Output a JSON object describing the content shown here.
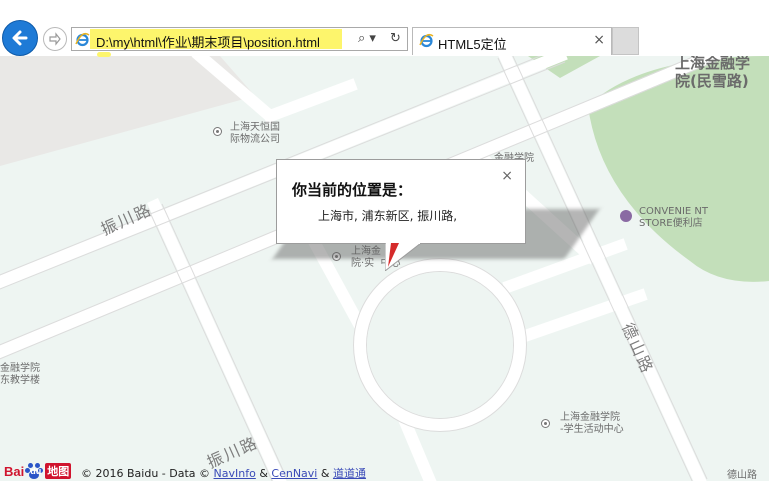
{
  "browser": {
    "back_label": "←",
    "forward_label": "⇨",
    "url": "D:\\my\\html\\作业\\期末项目\\position.html",
    "search_icon_glyph": "⌕ ▾",
    "refresh_glyph": "↻",
    "tab_title": "HTML5定位",
    "tab_close": "×"
  },
  "map": {
    "labels": {
      "tianheng": "上海天恒国\n际物流公司",
      "jinrong_top": "上海金融学\n院(民雪路)",
      "jinrong_partial": "金融学院\n  食堂",
      "convenience": "CONVENIE NT\nSTORE便利店",
      "shixun": "上海金\n院·实  中心",
      "jiaoxue": "金融学院\n东教学楼",
      "student_center": "上海金融学院\n-学生活动中心",
      "deshan_bottom": "德山路"
    },
    "roads": {
      "zhenchuan_1": "振川路",
      "zhenchuan_2": "振川路",
      "deshan": "德山路"
    }
  },
  "info_window": {
    "title": "你当前的位置是：",
    "address": "上海市, 浦东新区, 振川路,",
    "close": "×"
  },
  "footer": {
    "logo_bai": "Bai",
    "logo_du": "du",
    "logo_map": "地图",
    "copyright": "© 2016 Baidu - Data ©",
    "link_navinfo": "NavInfo",
    "amp1": "&",
    "link_cennavi": "CenNavi",
    "amp2": "&",
    "link_daodao": "道道通"
  },
  "colors": {
    "map_bg": "#eef5f2",
    "road": "#ffffff",
    "park": "#c3dfba",
    "marker": "#d52b2b"
  }
}
